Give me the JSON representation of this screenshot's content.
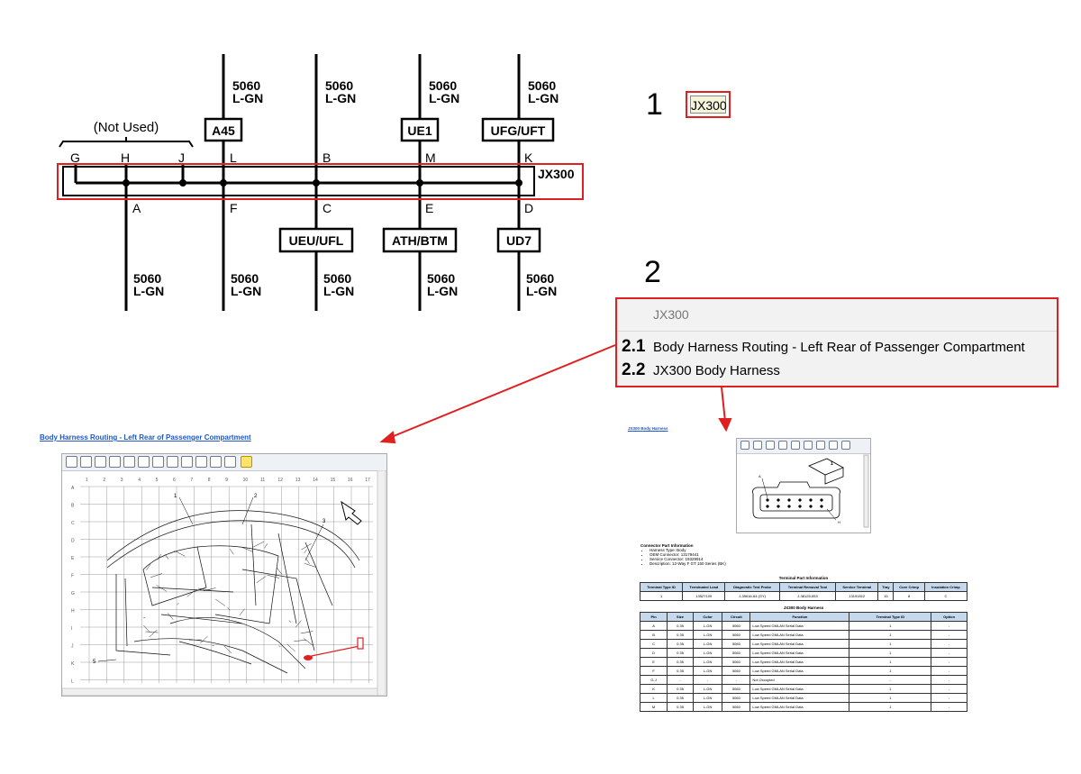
{
  "schematic": {
    "top_wires": [
      {
        "circuit": "5060",
        "color": "L-GN"
      },
      {
        "circuit": "5060",
        "color": "L-GN"
      },
      {
        "circuit": "5060",
        "color": "L-GN"
      },
      {
        "circuit": "5060",
        "color": "L-GN"
      }
    ],
    "top_options": [
      "A45",
      "UE1",
      "UFG/UFT"
    ],
    "not_used_label": "(Not Used)",
    "top_pins": [
      "G",
      "H",
      "J",
      "L",
      "B",
      "M",
      "K"
    ],
    "connector_label": "JX300",
    "bottom_pins": [
      "A",
      "F",
      "C",
      "E",
      "D"
    ],
    "bottom_options": [
      "UEU/UFL",
      "ATH/BTM",
      "UD7"
    ],
    "bottom_wires": [
      {
        "circuit": "5060",
        "color": "L-GN"
      },
      {
        "circuit": "5060",
        "color": "L-GN"
      },
      {
        "circuit": "5060",
        "color": "L-GN"
      },
      {
        "circuit": "5060",
        "color": "L-GN"
      },
      {
        "circuit": "5060",
        "color": "L-GN"
      }
    ]
  },
  "callouts": {
    "one": "1",
    "two": "2"
  },
  "connector_button_label": "JX300",
  "search_panel": {
    "query": "JX300",
    "results": [
      {
        "num": "2.1",
        "label": "Body Harness Routing - Left Rear of Passenger Compartment"
      },
      {
        "num": "2.2",
        "label": "JX300 Body Harness"
      }
    ]
  },
  "routing_doc": {
    "title": "Body Harness Routing - Left Rear of Passenger Compartment",
    "col_labels": [
      "1",
      "2",
      "3",
      "4",
      "5",
      "6",
      "7",
      "8",
      "9",
      "10",
      "11",
      "12",
      "13",
      "14",
      "15",
      "16",
      "17"
    ],
    "row_labels": [
      "A",
      "B",
      "C",
      "D",
      "E",
      "F",
      "G",
      "H",
      "I",
      "J",
      "K",
      "L"
    ],
    "callouts": [
      "1",
      "2",
      "3",
      "5"
    ]
  },
  "connector_doc": {
    "title": "JX300 Body Harness",
    "image_callouts": [
      "1",
      "A",
      "H"
    ],
    "part_info_heading": "Connector Part Information",
    "part_info": [
      "Harness Type: Body",
      "OEM Connector: 13179441",
      "Service Connector: 19329914",
      "Description: 12-Way F GT 150 Series (BK)"
    ],
    "terminal_table": {
      "title": "Terminal Part Information",
      "headers": [
        "Terminal Type ID",
        "Terminated Lead",
        "Diagnostic Test Probe",
        "Terminal Removal Tool",
        "Service Terminal",
        "Tray",
        "Core Crimp",
        "Insulation Crimp"
      ],
      "rows": [
        [
          "1",
          "13527109",
          "J-35616-64 (GY)",
          "J-38125-553",
          "13191812",
          "15",
          "8",
          "C"
        ]
      ]
    },
    "pin_table": {
      "title": "JX300 Body Harness",
      "headers": [
        "Pin",
        "Size",
        "Color",
        "Circuit",
        "Function",
        "Terminal Type ID",
        "Option"
      ],
      "rows": [
        [
          "A",
          "0.35",
          "L-GN",
          "5060",
          "Low Speed GMLAN Serial Data",
          "1",
          "-"
        ],
        [
          "B",
          "0.35",
          "L-GN",
          "5060",
          "Low Speed GMLAN Serial Data",
          "1",
          "-"
        ],
        [
          "C",
          "0.35",
          "L-GN",
          "5060",
          "Low Speed GMLAN Serial Data",
          "1",
          "-"
        ],
        [
          "D",
          "0.35",
          "L-GN",
          "5060",
          "Low Speed GMLAN Serial Data",
          "1",
          "-"
        ],
        [
          "E",
          "0.35",
          "L-GN",
          "5060",
          "Low Speed GMLAN Serial Data",
          "1",
          "-"
        ],
        [
          "F",
          "0.35",
          "L-GN",
          "5060",
          "Low Speed GMLAN Serial Data",
          "1",
          "-"
        ],
        [
          "G-J",
          "-",
          "-",
          "-",
          "Not Occupied",
          "-",
          "-"
        ],
        [
          "K",
          "0.35",
          "L-GN",
          "5060",
          "Low Speed GMLAN Serial Data",
          "1",
          "-"
        ],
        [
          "L",
          "0.35",
          "L-GN",
          "5060",
          "Low Speed GMLAN Serial Data",
          "1",
          "-"
        ],
        [
          "M",
          "0.35",
          "L-GN",
          "5060",
          "Low Speed GMLAN Serial Data",
          "1",
          "-"
        ]
      ]
    }
  }
}
